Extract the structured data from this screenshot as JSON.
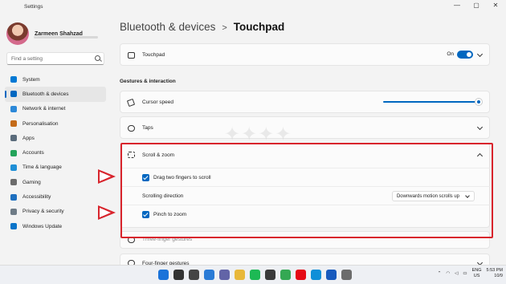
{
  "window": {
    "title": "Settings",
    "controls": [
      "—",
      "▢",
      "✕"
    ]
  },
  "sidebar": {
    "user_name": "Zarmeen Shahzad",
    "search_placeholder": "Find a setting",
    "items": [
      {
        "label": "System",
        "icon": "monitor-icon",
        "color": "#0078d4",
        "active": false
      },
      {
        "label": "Bluetooth & devices",
        "icon": "bluetooth-icon",
        "color": "#0067c0",
        "active": true
      },
      {
        "label": "Network & internet",
        "icon": "wifi-icon",
        "color": "#2b88d8",
        "active": false
      },
      {
        "label": "Personalisation",
        "icon": "brush-icon",
        "color": "#c46b19",
        "active": false
      },
      {
        "label": "Apps",
        "icon": "apps-icon",
        "color": "#5a6b7b",
        "active": false
      },
      {
        "label": "Accounts",
        "icon": "person-icon",
        "color": "#23a35a",
        "active": false
      },
      {
        "label": "Time & language",
        "icon": "globe-clock-icon",
        "color": "#1f8fd6",
        "active": false
      },
      {
        "label": "Gaming",
        "icon": "gamepad-icon",
        "color": "#6b6b6b",
        "active": false
      },
      {
        "label": "Accessibility",
        "icon": "accessibility-icon",
        "color": "#1e6fbf",
        "active": false
      },
      {
        "label": "Privacy & security",
        "icon": "shield-icon",
        "color": "#6e7b86",
        "active": false
      },
      {
        "label": "Windows Update",
        "icon": "update-icon",
        "color": "#0a74c9",
        "active": false
      }
    ]
  },
  "breadcrumb": {
    "parent": "Bluetooth & devices",
    "separator": ">",
    "current": "Touchpad"
  },
  "touchpad": {
    "label": "Touchpad",
    "toggle_text": "On",
    "toggle_on": true
  },
  "gestures": {
    "heading": "Gestures & interaction",
    "cursor_speed_label": "Cursor speed",
    "cursor_speed_value": 1.0,
    "taps_label": "Taps",
    "scroll_zoom_label": "Scroll & zoom",
    "drag_two_fingers_label": "Drag two fingers to scroll",
    "drag_two_fingers_checked": true,
    "scrolling_direction_label": "Scrolling direction",
    "scrolling_direction_value": "Downwards motion scrolls up",
    "pinch_to_zoom_label": "Pinch to zoom",
    "pinch_to_zoom_checked": true,
    "three_finger_label": "Three-finger gestures",
    "four_finger_label": "Four-finger gestures"
  },
  "annotation_color": "#d8242c",
  "accent_color": "#0067c0",
  "taskbar": {
    "icons": [
      {
        "name": "windows-start-icon",
        "color": "#1a73d9"
      },
      {
        "name": "search-icon",
        "color": "#333333"
      },
      {
        "name": "task-view-icon",
        "color": "#444444"
      },
      {
        "name": "widgets-icon",
        "color": "#2a7bd6"
      },
      {
        "name": "chat-icon",
        "color": "#6264a7"
      },
      {
        "name": "file-explorer-icon",
        "color": "#e8b83a"
      },
      {
        "name": "spotify-icon",
        "color": "#1db954"
      },
      {
        "name": "store-icon",
        "color": "#3a3a3a"
      },
      {
        "name": "chrome-icon",
        "color": "#34a853"
      },
      {
        "name": "netflix-icon",
        "color": "#e50914"
      },
      {
        "name": "edge-icon",
        "color": "#0f8fd8"
      },
      {
        "name": "word-icon",
        "color": "#185abd"
      },
      {
        "name": "settings-icon",
        "color": "#6c6c6c"
      }
    ],
    "lang_top": "ENG",
    "lang_bottom": "US",
    "time": "5:53 PM",
    "date": "10/9"
  }
}
